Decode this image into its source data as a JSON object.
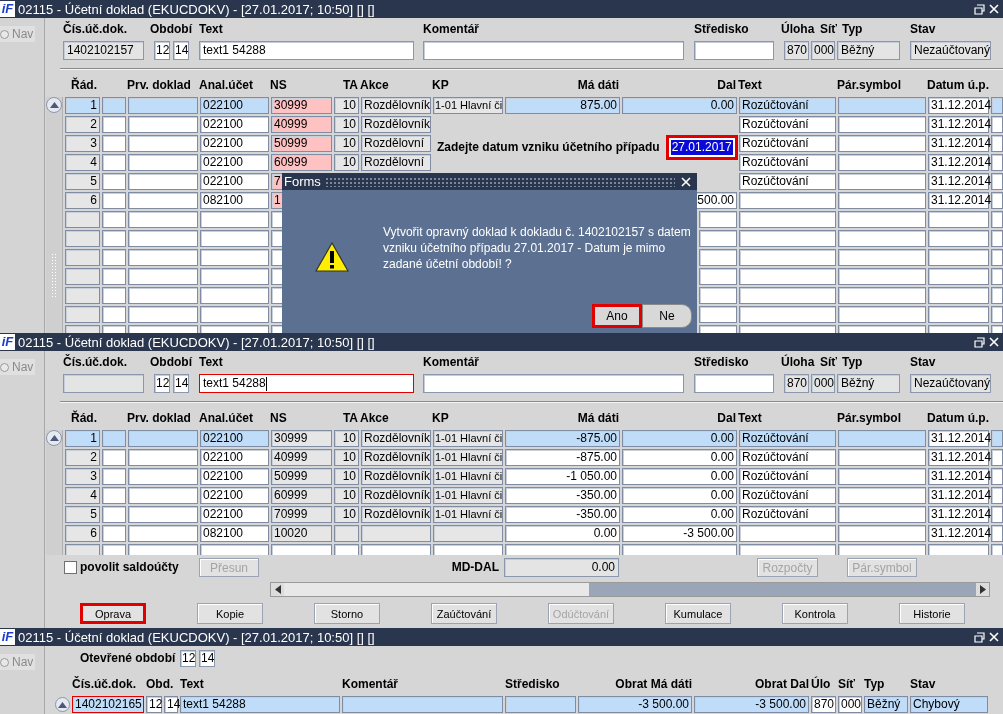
{
  "top_window": {
    "logo": "iF",
    "title": "02115 - Účetní doklad (EKUCDOKV) - [27.01.2017; 10:50] [] []",
    "nav": "Nav",
    "nav_selected": false,
    "header": {
      "labels": [
        "Čís.úč.dok.",
        "Období",
        "Text",
        "Komentář",
        "Středisko",
        "Úloha",
        "Síť",
        "Typ",
        "Stav"
      ],
      "doc": "1402102157",
      "month": "12",
      "year": "14",
      "text": "text1 54288",
      "text_focused": false,
      "task": "870",
      "net": "000",
      "type": "Běžný",
      "state": "Nezaúčtovaný"
    },
    "columns": [
      "Řád.",
      "Prv. doklad",
      "Anal.účet",
      "NS",
      "TA",
      "Akce",
      "KP",
      "Má dáti",
      "Dal",
      "Text",
      "Pár.symbol",
      "Datum ú.p."
    ],
    "rows": [
      {
        "selected": true,
        "ns_error": true,
        "line": "1",
        "anal": "022100",
        "ns": "30999",
        "ta": "10",
        "akce": "Rozdělovník",
        "kp": "1-01 Hlavní či",
        "md": "875.00",
        "dal": "0.00",
        "text": "Rozúčtování",
        "date": "31.12.2014"
      },
      {
        "selected": false,
        "ns_error": true,
        "line": "2",
        "anal": "022100",
        "ns": "40999",
        "ta": "10",
        "akce": "Rozdělovník",
        "text": "Rozúčtování",
        "date": "31.12.2014"
      },
      {
        "selected": false,
        "ns_error": true,
        "line": "3",
        "anal": "022100",
        "ns": "50999",
        "ta": "10",
        "akce": "Rozdělovní",
        "text": "Rozúčtování",
        "date": "31.12.2014"
      },
      {
        "selected": false,
        "ns_error": true,
        "line": "4",
        "anal": "022100",
        "ns": "60999",
        "ta": "10",
        "akce": "Rozdělovní",
        "text": "Rozúčtování",
        "date": "31.12.2014"
      },
      {
        "selected": false,
        "ns_error": true,
        "line": "5",
        "anal": "022100",
        "ns": "7",
        "text": "Rozúčtování",
        "date": "31.12.2014"
      },
      {
        "selected": false,
        "ns_error": true,
        "line": "6",
        "anal": "082100",
        "ns": "1",
        "dal": "500.00",
        "date": "31.12.2014"
      }
    ],
    "date_prompt": {
      "label": "Zadejte datum vzniku účetního případu",
      "value": "27.01.2017",
      "highlighted": true
    },
    "dialog": {
      "title": "Forms",
      "message": "Vytvořit opravný doklad k dokladu č. 1402102157 s datem vzniku účetního případu 27.01.2017 - Datum je mimo zadané účetní období! ?",
      "buttons": [
        {
          "label": "Ano",
          "highlighted": true
        },
        {
          "label": "Ne",
          "highlighted": false
        }
      ]
    }
  },
  "middle_window": {
    "logo": "iF",
    "title": "02115 - Účetní doklad (EKUCDOKV) - [27.01.2017; 10:50] [] []",
    "nav": "Nav",
    "nav_selected": false,
    "header": {
      "labels": [
        "Čís.úč.dok.",
        "Období",
        "Text",
        "Komentář",
        "Středisko",
        "Úloha",
        "Síť",
        "Typ",
        "Stav"
      ],
      "month": "12",
      "year": "14",
      "text": "text1 54288",
      "text_focused": true,
      "task": "870",
      "net": "000",
      "type": "Běžný",
      "state": "Nezaúčtovaný"
    },
    "columns": [
      "Řád.",
      "Prv. doklad",
      "Anal.účet",
      "NS",
      "TA",
      "Akce",
      "KP",
      "Má dáti",
      "Dal",
      "Text",
      "Pár.symbol",
      "Datum ú.p."
    ],
    "rows": [
      {
        "selected": true,
        "ns_error": false,
        "line": "1",
        "anal": "022100",
        "ns": "30999",
        "ta": "10",
        "akce": "Rozdělovník",
        "kp": "1-01 Hlavní či",
        "md": "-875.00",
        "dal": "0.00",
        "text": "Rozúčtování",
        "date": "31.12.2014"
      },
      {
        "selected": false,
        "ns_error": false,
        "line": "2",
        "anal": "022100",
        "ns": "40999",
        "ta": "10",
        "akce": "Rozdělovník",
        "kp": "1-01 Hlavní či",
        "md": "-875.00",
        "dal": "0.00",
        "text": "Rozúčtování",
        "date": "31.12.2014"
      },
      {
        "selected": false,
        "ns_error": false,
        "line": "3",
        "anal": "022100",
        "ns": "50999",
        "ta": "10",
        "akce": "Rozdělovník",
        "kp": "1-01 Hlavní či",
        "md": "-1 050.00",
        "dal": "0.00",
        "text": "Rozúčtování",
        "date": "31.12.2014"
      },
      {
        "selected": false,
        "ns_error": false,
        "line": "4",
        "anal": "022100",
        "ns": "60999",
        "ta": "10",
        "akce": "Rozdělovník",
        "kp": "1-01 Hlavní či",
        "md": "-350.00",
        "dal": "0.00",
        "text": "Rozúčtování",
        "date": "31.12.2014"
      },
      {
        "selected": false,
        "ns_error": false,
        "line": "5",
        "anal": "022100",
        "ns": "70999",
        "ta": "10",
        "akce": "Rozdělovník",
        "kp": "1-01 Hlavní či",
        "md": "-350.00",
        "dal": "0.00",
        "text": "Rozúčtování",
        "date": "31.12.2014"
      },
      {
        "selected": false,
        "ns_error": false,
        "line": "6",
        "anal": "082100",
        "ns": "10020",
        "md": "0.00",
        "dal": "-3 500.00",
        "date": "31.12.2014"
      }
    ],
    "saldo": {
      "label": "povolit saldoúčty",
      "checked": false
    },
    "move_button": {
      "label": "Přesun",
      "disabled": true
    },
    "md_dal": {
      "label": "MD-DAL",
      "value": "0.00"
    },
    "budget_button": {
      "label": "Rozpočty",
      "disabled": true
    },
    "pair_button": {
      "label": "Pár.symbol",
      "disabled": true
    },
    "actions": [
      {
        "label": "Oprava",
        "disabled": false,
        "highlighted": true
      },
      {
        "label": "Kopie",
        "disabled": false,
        "highlighted": false
      },
      {
        "label": "Storno",
        "disabled": false,
        "highlighted": false
      },
      {
        "label": "Zaúčtování",
        "disabled": false,
        "highlighted": false
      },
      {
        "label": "Odúčtování",
        "disabled": true,
        "highlighted": false
      },
      {
        "label": "Kumulace",
        "disabled": false,
        "highlighted": false
      },
      {
        "label": "Kontrola",
        "disabled": false,
        "highlighted": false
      },
      {
        "label": "Historie",
        "disabled": false,
        "highlighted": false
      }
    ]
  },
  "bottom_window": {
    "logo": "iF",
    "title": "02115 - Účetní doklad (EKUCDOKV) - [27.01.2017; 10:50] [] []",
    "nav": "Nav",
    "nav_selected": false,
    "open_period": {
      "label": "Otevřené období",
      "month": "12",
      "year": "14"
    },
    "columns": [
      "Čís.úč.dok.",
      "Obd.",
      "Text",
      "Komentář",
      "Středisko",
      "Obrat Má dáti",
      "Obrat Dal",
      "Úlo",
      "Síť",
      "Typ",
      "Stav"
    ],
    "row": {
      "selected": true,
      "doc_focused": true,
      "doc": "1402102165",
      "month": "12",
      "year": "14",
      "text": "text1 54288",
      "md": "-3 500.00",
      "dal": "-3 500.00",
      "task": "870",
      "net": "000",
      "type": "Běžný",
      "state": "Chybový"
    }
  }
}
